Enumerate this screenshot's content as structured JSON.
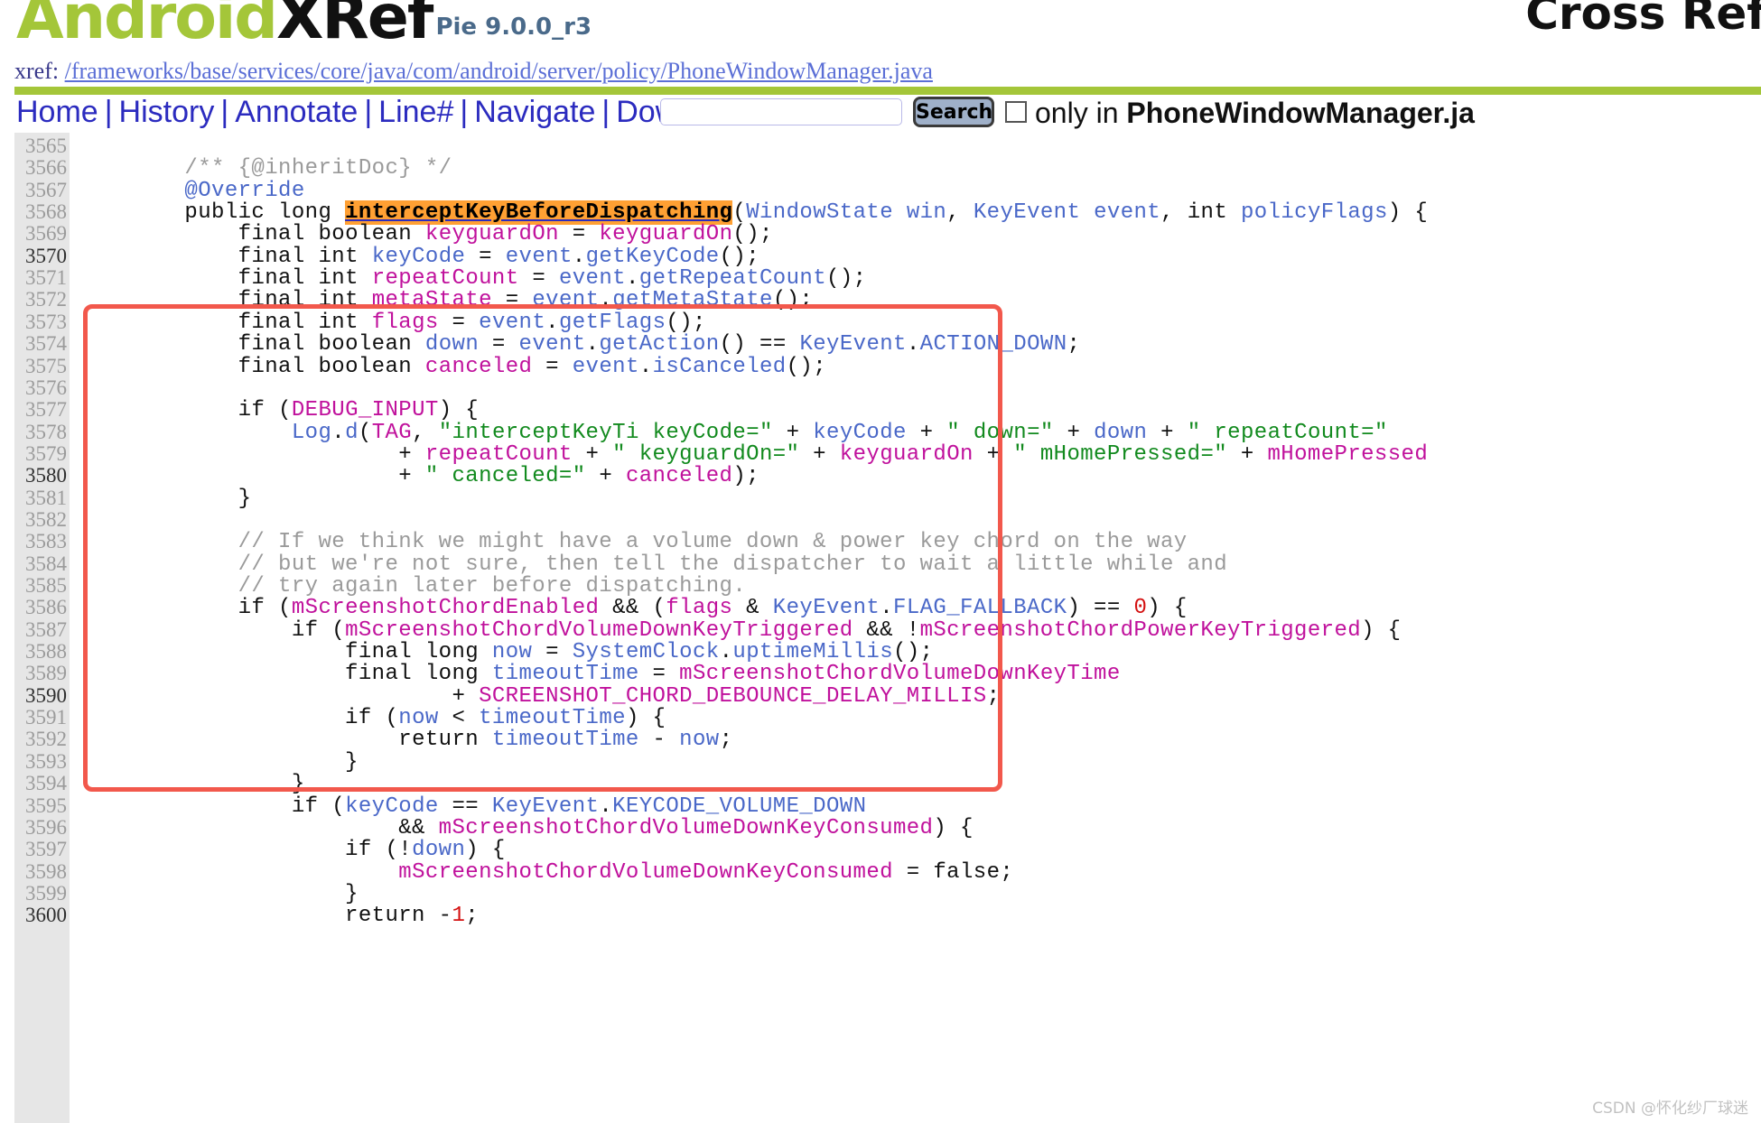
{
  "header": {
    "logo_android": "Android",
    "logo_xref": "XRef",
    "version": "Pie 9.0.0_r3",
    "cross_ref": "Cross Ref"
  },
  "xref": {
    "label": "xref:",
    "path": "/frameworks/base/services/core/java/com/android/server/policy/PhoneWindowManager.java"
  },
  "nav": {
    "items": [
      "Home",
      "History",
      "Annotate",
      "Line#",
      "Navigate",
      "Download"
    ],
    "separator": "|",
    "search_value": "",
    "search_placeholder": "",
    "search_button": "Search",
    "only_in_prefix": "only in ",
    "only_in_file": "PhoneWindowManager.ja"
  },
  "code": {
    "first_line": 3565,
    "highlight_symbol": "interceptKeyBeforeDispatching",
    "lines": [
      {
        "n": 3565,
        "text": ""
      },
      {
        "n": 3566,
        "text": "        /** {@inheritDoc} */"
      },
      {
        "n": 3567,
        "text": "        @Override"
      },
      {
        "n": 3568,
        "text": "        public long interceptKeyBeforeDispatching(WindowState win, KeyEvent event, int policyFlags) {"
      },
      {
        "n": 3569,
        "text": "            final boolean keyguardOn = keyguardOn();"
      },
      {
        "n": 3570,
        "text": "            final int keyCode = event.getKeyCode();"
      },
      {
        "n": 3571,
        "text": "            final int repeatCount = event.getRepeatCount();"
      },
      {
        "n": 3572,
        "text": "            final int metaState = event.getMetaState();"
      },
      {
        "n": 3573,
        "text": "            final int flags = event.getFlags();"
      },
      {
        "n": 3574,
        "text": "            final boolean down = event.getAction() == KeyEvent.ACTION_DOWN;"
      },
      {
        "n": 3575,
        "text": "            final boolean canceled = event.isCanceled();"
      },
      {
        "n": 3576,
        "text": ""
      },
      {
        "n": 3577,
        "text": "            if (DEBUG_INPUT) {"
      },
      {
        "n": 3578,
        "text": "                Log.d(TAG, \"interceptKeyTi keyCode=\" + keyCode + \" down=\" + down + \" repeatCount=\""
      },
      {
        "n": 3579,
        "text": "                        + repeatCount + \" keyguardOn=\" + keyguardOn + \" mHomePressed=\" + mHomePressed"
      },
      {
        "n": 3580,
        "text": "                        + \" canceled=\" + canceled);"
      },
      {
        "n": 3581,
        "text": "            }"
      },
      {
        "n": 3582,
        "text": ""
      },
      {
        "n": 3583,
        "text": "            // If we think we might have a volume down & power key chord on the way"
      },
      {
        "n": 3584,
        "text": "            // but we're not sure, then tell the dispatcher to wait a little while and"
      },
      {
        "n": 3585,
        "text": "            // try again later before dispatching."
      },
      {
        "n": 3586,
        "text": "            if (mScreenshotChordEnabled && (flags & KeyEvent.FLAG_FALLBACK) == 0) {"
      },
      {
        "n": 3587,
        "text": "                if (mScreenshotChordVolumeDownKeyTriggered && !mScreenshotChordPowerKeyTriggered) {"
      },
      {
        "n": 3588,
        "text": "                    final long now = SystemClock.uptimeMillis();"
      },
      {
        "n": 3589,
        "text": "                    final long timeoutTime = mScreenshotChordVolumeDownKeyTime"
      },
      {
        "n": 3590,
        "text": "                            + SCREENSHOT_CHORD_DEBOUNCE_DELAY_MILLIS;"
      },
      {
        "n": 3591,
        "text": "                    if (now < timeoutTime) {"
      },
      {
        "n": 3592,
        "text": "                        return timeoutTime - now;"
      },
      {
        "n": 3593,
        "text": "                    }"
      },
      {
        "n": 3594,
        "text": "                }"
      },
      {
        "n": 3595,
        "text": "                if (keyCode == KeyEvent.KEYCODE_VOLUME_DOWN"
      },
      {
        "n": 3596,
        "text": "                        && mScreenshotChordVolumeDownKeyConsumed) {"
      },
      {
        "n": 3597,
        "text": "                    if (!down) {"
      },
      {
        "n": 3598,
        "text": "                        mScreenshotChordVolumeDownKeyConsumed = false;"
      },
      {
        "n": 3599,
        "text": "                    }"
      },
      {
        "n": 3600,
        "text": "                    return -1;"
      }
    ]
  },
  "annotation": {
    "box_color": "#f2584c",
    "highlight_bg": "#ffa033"
  },
  "watermark": "CSDN @怀化纱厂球迷"
}
